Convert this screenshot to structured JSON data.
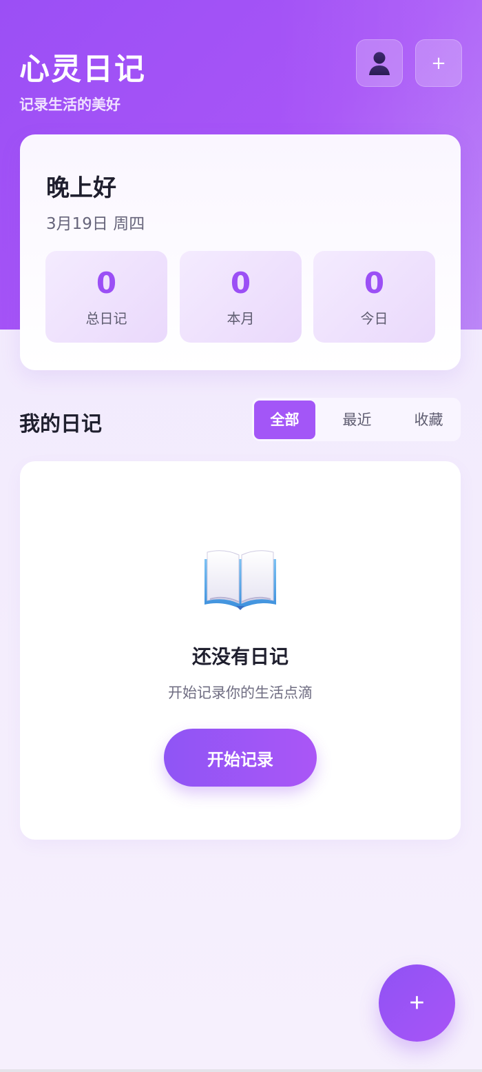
{
  "header": {
    "title": "心灵日记",
    "subtitle": "记录生活的美好",
    "profile_icon": "user-silhouette-icon",
    "add_label": "+"
  },
  "welcome": {
    "greeting": "晚上好",
    "date": "3月19日 周四",
    "stats": [
      {
        "value": "0",
        "label": "总日记"
      },
      {
        "value": "0",
        "label": "本月"
      },
      {
        "value": "0",
        "label": "今日"
      }
    ]
  },
  "diary": {
    "section_title": "我的日记",
    "tabs": [
      {
        "label": "全部",
        "active": true
      },
      {
        "label": "最近",
        "active": false
      },
      {
        "label": "收藏",
        "active": false
      }
    ]
  },
  "empty_state": {
    "icon": "open-book-icon",
    "title": "还没有日记",
    "description": "开始记录你的生活点滴",
    "button_label": "开始记录"
  },
  "fab": {
    "label": "+"
  },
  "colors": {
    "accent": "#a855f7",
    "accent_dark": "#9052f4",
    "text_primary": "#1f1f2e",
    "text_secondary": "#66647a"
  }
}
